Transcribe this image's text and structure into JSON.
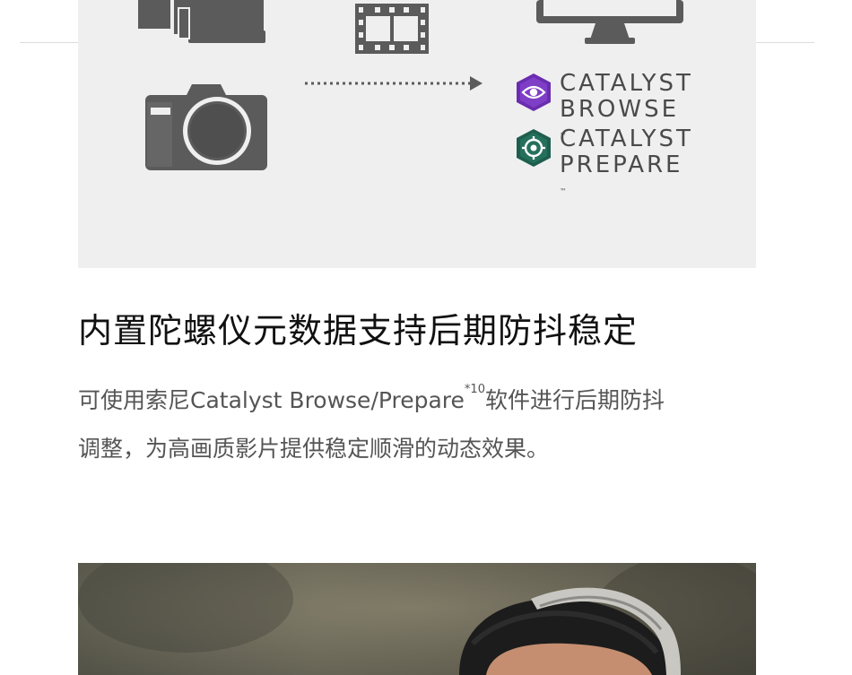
{
  "panel": {
    "logos": [
      {
        "name": "catalyst-browse",
        "line1": "CATALYST",
        "line2": "BROWSE",
        "tm": "™",
        "color": "#6a2cb0"
      },
      {
        "name": "catalyst-prepare",
        "line1": "CATALYST",
        "line2": "PREPARE",
        "tm": "™",
        "color": "#1e5e4e"
      }
    ]
  },
  "heading": "内置陀螺仪元数据支持后期防抖稳定",
  "description": {
    "part1": "可使用索尼Catalyst Browse/Prepare",
    "footnote": "*10",
    "part2": "软件进行后期防抖",
    "line2": "调整，为高画质影片提供稳定顺滑的动态效果。"
  },
  "colors": {
    "icon_gray": "#5b5b5b",
    "panel_bg": "#efefef"
  }
}
